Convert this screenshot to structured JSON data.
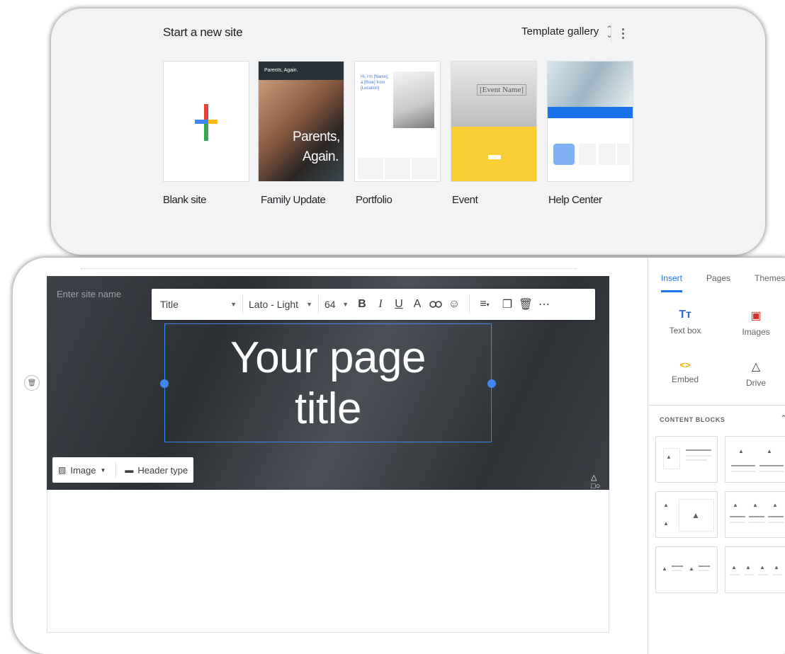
{
  "top": {
    "title": "Start a new site",
    "template_gallery_label": "Template gallery",
    "templates": [
      {
        "label": "Blank site"
      },
      {
        "label": "Family Update",
        "thumb_bar": "Parents, Again.",
        "thumb_title_1": "Parents,",
        "thumb_title_2": "Again."
      },
      {
        "label": "Portfolio",
        "thumb_text": "Hi, I'm [Name], a [Role] from [Location]"
      },
      {
        "label": "Event",
        "thumb_text": "[Event Name]"
      },
      {
        "label": "Help Center"
      }
    ]
  },
  "editor": {
    "site_name_placeholder": "Enter site name",
    "toolbar": {
      "style": "Title",
      "font": "Lato - Light",
      "size": "64",
      "bold": "B",
      "italic": "I",
      "underline": "U",
      "text_color": "A"
    },
    "page_title_line_1": "Your page",
    "page_title_line_2": "title",
    "header_tools": {
      "image_label": "Image",
      "header_type_label": "Header type"
    }
  },
  "right_panel": {
    "tabs": [
      "Insert",
      "Pages",
      "Themes"
    ],
    "active_tab": "Insert",
    "items": [
      {
        "label": "Text box",
        "glyph": "Tт",
        "color": "#3367d6"
      },
      {
        "label": "Images",
        "glyph": "▣",
        "color": "#d93025"
      },
      {
        "label": "Embed",
        "glyph": "<>",
        "color": "#f9ab00"
      },
      {
        "label": "Drive",
        "glyph": "△",
        "color": "#3c4043"
      }
    ],
    "content_blocks_title": "CONTENT BLOCKS"
  },
  "colors": {
    "accent": "#4285f4",
    "google_blue": "#4285f4",
    "google_red": "#ea4335",
    "google_yellow": "#fbbc04",
    "google_green": "#34a853"
  }
}
